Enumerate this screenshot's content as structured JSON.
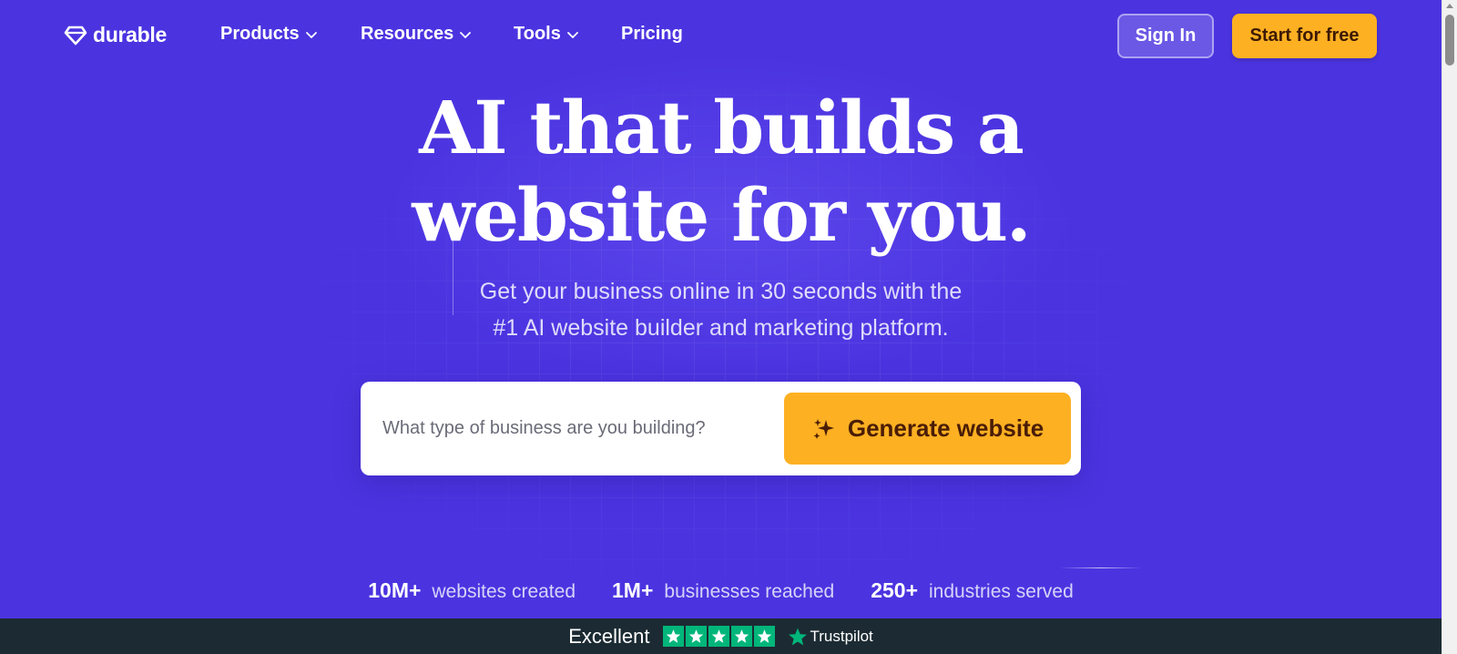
{
  "brand": {
    "name": "durable",
    "icon": "diamond-logo-icon"
  },
  "nav": {
    "items": [
      {
        "label": "Products",
        "has_dropdown": true
      },
      {
        "label": "Resources",
        "has_dropdown": true
      },
      {
        "label": "Tools",
        "has_dropdown": true
      },
      {
        "label": "Pricing",
        "has_dropdown": false
      }
    ],
    "sign_in": "Sign In",
    "start_free": "Start for free"
  },
  "hero": {
    "title_line1": "AI that builds a",
    "title_line2": "website for you.",
    "subtitle_line1": "Get your business online in 30 seconds with the",
    "subtitle_line2": "#1 AI website builder and marketing platform."
  },
  "search": {
    "placeholder": "What type of business are you building?",
    "button_label": "Generate website",
    "button_icon": "sparkle-icon"
  },
  "stats": [
    {
      "value": "10M+",
      "label": "websites created"
    },
    {
      "value": "1M+",
      "label": "businesses reached"
    },
    {
      "value": "250+",
      "label": "industries served"
    }
  ],
  "trustpilot": {
    "rating_label": "Excellent",
    "stars": 5,
    "brand": "Trustpilot"
  },
  "colors": {
    "background": "#4b34e0",
    "accent": "#fdb022",
    "trust_bar": "#1c2b33",
    "trust_green": "#00b67a"
  }
}
